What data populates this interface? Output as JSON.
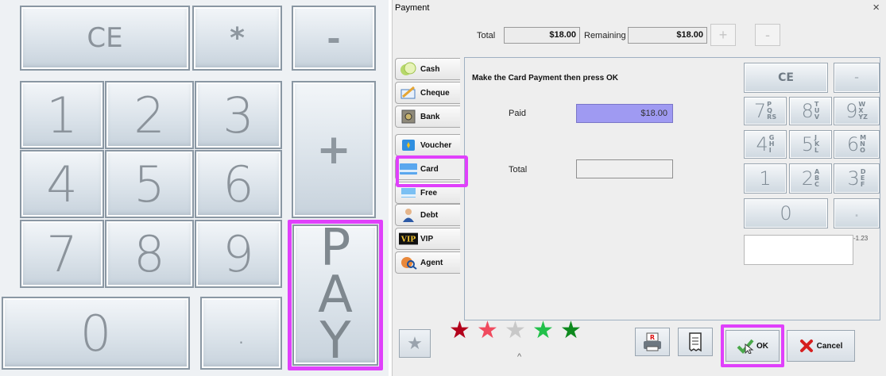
{
  "keypad": {
    "keys": {
      "ce": "CE",
      "star": "*",
      "minus": "-",
      "plus": "+",
      "d1": "1",
      "d2": "2",
      "d3": "3",
      "d4": "4",
      "d5": "5",
      "d6": "6",
      "d7": "7",
      "d8": "8",
      "d9": "9",
      "d0": "0",
      "dot": "."
    },
    "pay_letters": [
      "P",
      "A",
      "Y"
    ]
  },
  "dialog": {
    "title": "Payment",
    "close": "×",
    "total_label": "Total",
    "total_value": "$18.00",
    "remaining_label": "Remaining",
    "remaining_value": "$18.00",
    "plus": "+",
    "minus": "-",
    "tabs": [
      {
        "label": "Cash",
        "icon": "cash-icon"
      },
      {
        "label": "Cheque",
        "icon": "cheque-icon"
      },
      {
        "label": "Bank",
        "icon": "bank-icon"
      },
      {
        "label": "Voucher",
        "icon": "voucher-icon"
      },
      {
        "label": "Card",
        "icon": "card-icon"
      },
      {
        "label": "Free",
        "icon": "free-icon"
      },
      {
        "label": "Debt",
        "icon": "debt-icon"
      },
      {
        "label": "VIP",
        "icon": "vip-icon"
      },
      {
        "label": "Agent",
        "icon": "agent-icon"
      }
    ],
    "active_tab": "Card",
    "instruction": "Make the Card Payment then press OK",
    "paid_label": "Paid",
    "paid_value": "$18.00",
    "total_field_label": "Total",
    "total_field_value": "",
    "numpad": {
      "ce": "CE",
      "minus": "-",
      "dot": ".",
      "k7": "7",
      "k7_sub": [
        "P",
        "Q",
        "RS"
      ],
      "k8": "8",
      "k8_sub": [
        "T",
        "U",
        "V"
      ],
      "k9": "9",
      "k9_sub": [
        "W",
        "X",
        "YZ"
      ],
      "k4": "4",
      "k4_sub": [
        "G",
        "H",
        "I"
      ],
      "k5": "5",
      "k5_sub": [
        "J",
        "K",
        "L"
      ],
      "k6": "6",
      "k6_sub": [
        "M",
        "N",
        "O"
      ],
      "k1": "1",
      "k2": "2",
      "k2_sub": [
        "A",
        "B",
        "C"
      ],
      "k3": "3",
      "k3_sub": [
        "D",
        "E",
        "F"
      ],
      "k0": "0"
    },
    "display_value": "-1.23",
    "stars": [
      {
        "color": "#b3001b"
      },
      {
        "color": "#f04a5e"
      },
      {
        "color": "#c8c8c8"
      },
      {
        "color": "#22c04a"
      },
      {
        "color": "#0e8a1e"
      }
    ],
    "caret": "^",
    "ok_label": "OK",
    "cancel_label": "Cancel"
  }
}
